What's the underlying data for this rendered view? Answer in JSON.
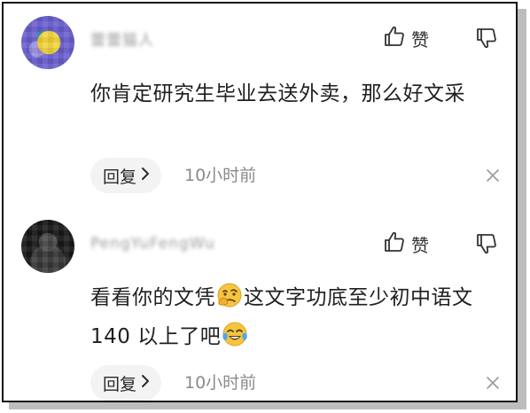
{
  "comments": [
    {
      "username": "蕾蕾猫人",
      "like_label": "赞",
      "text": "你肯定研究生毕业去送外卖，那么好文采",
      "reply_label": "回复",
      "time": "10小时前"
    },
    {
      "username": "PengYuFengWu",
      "like_label": "赞",
      "text_part1": "看看你的文凭",
      "text_part2": "这文字功底至少初中语文 140 以上了吧",
      "reply_label": "回复",
      "time": "10小时前"
    }
  ],
  "icons": {
    "like": "thumbs-up-outline-icon",
    "dislike": "thumbs-down-outline-icon",
    "reply_chevron": "chevron-right-icon",
    "close": "close-icon",
    "emoji_1": "thinking-face-emoji",
    "emoji_2": "tears-of-joy-emoji"
  },
  "colors": {
    "text_primary": "#1f1f1f",
    "text_secondary": "#8a8a8a",
    "pill_bg": "#f3f3f3"
  }
}
